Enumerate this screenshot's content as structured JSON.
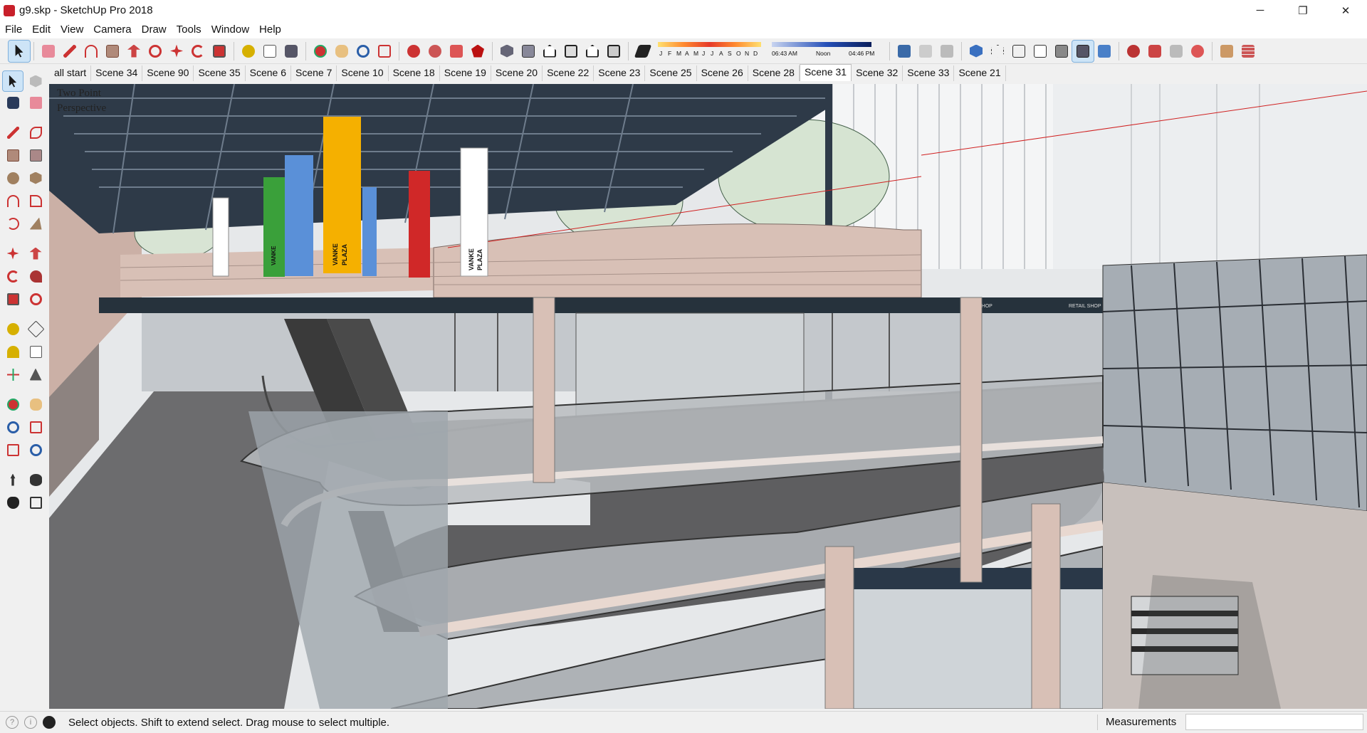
{
  "window": {
    "title": "g9.skp - SketchUp Pro 2018",
    "controls": [
      "─",
      "❐",
      "✕"
    ]
  },
  "menu": [
    "File",
    "Edit",
    "View",
    "Camera",
    "Draw",
    "Tools",
    "Window",
    "Help"
  ],
  "shadow": {
    "months": [
      "J",
      "F",
      "M",
      "A",
      "M",
      "J",
      "J",
      "A",
      "S",
      "O",
      "N",
      "D"
    ],
    "time_start": "06:43 AM",
    "time_mid": "Noon",
    "time_end": "04:46 PM"
  },
  "scenes": [
    "all start",
    "Scene 34",
    "Scene 90",
    "Scene 35",
    "Scene 6",
    "Scene 7",
    "Scene 10",
    "Scene 18",
    "Scene 19",
    "Scene 20",
    "Scene 22",
    "Scene 23",
    "Scene 25",
    "Scene 26",
    "Scene 28",
    "Scene 31",
    "Scene 32",
    "Scene 33",
    "Scene 21"
  ],
  "active_scene": "Scene 31",
  "viewport": {
    "camera_line1": "Two Point",
    "camera_line2": "Perspective",
    "banner_text_1": "VANKE",
    "banner_text_2": "PLAZA",
    "sign_1": "SHOP",
    "sign_2": "RETAIL SHOP"
  },
  "status": {
    "message": "Select objects. Shift to extend select. Drag mouse to select multiple.",
    "measurements_label": "Measurements",
    "measurements_value": ""
  }
}
